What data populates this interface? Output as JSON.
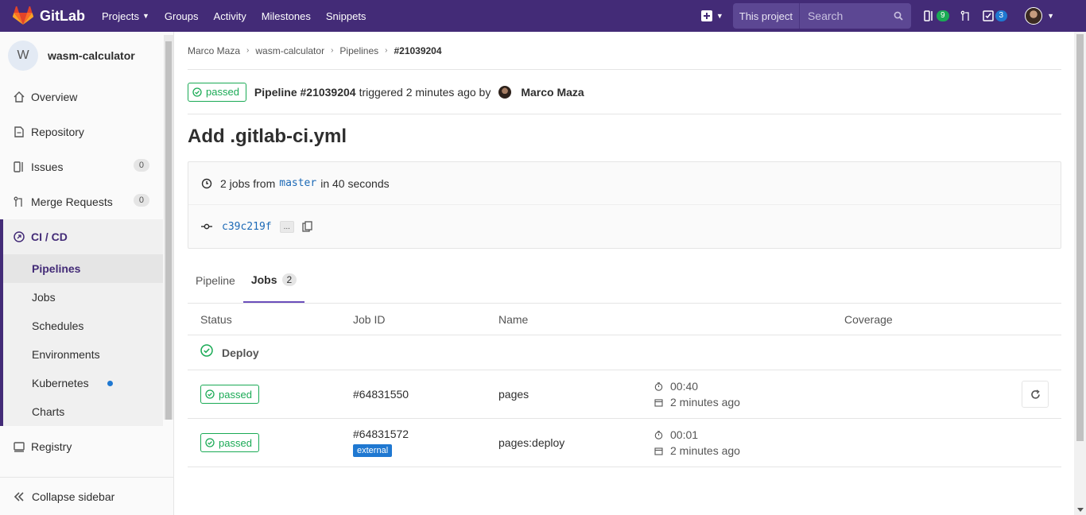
{
  "navbar": {
    "brand": "GitLab",
    "links": [
      "Projects",
      "Groups",
      "Activity",
      "Milestones",
      "Snippets"
    ],
    "search_scope": "This project",
    "search_placeholder": "Search",
    "issues_count": "9",
    "todos_count": "3",
    "colors": {
      "bg": "#432b77",
      "issues_badge": "#1aaa55",
      "todos_badge": "#1f78d1"
    }
  },
  "sidebar": {
    "project_initial": "W",
    "project_name": "wasm-calculator",
    "items": [
      {
        "label": "Overview",
        "icon": "home-icon"
      },
      {
        "label": "Repository",
        "icon": "doc-icon"
      },
      {
        "label": "Issues",
        "icon": "issues-icon",
        "count": "0"
      },
      {
        "label": "Merge Requests",
        "icon": "merge-request-icon",
        "count": "0"
      }
    ],
    "ci": {
      "label": "CI / CD",
      "sub": [
        "Pipelines",
        "Jobs",
        "Schedules",
        "Environments",
        "Kubernetes",
        "Charts"
      ]
    },
    "registry": "Registry",
    "collapse": "Collapse sidebar"
  },
  "breadcrumb": [
    "Marco Maza",
    "wasm-calculator",
    "Pipelines",
    "#21039204"
  ],
  "pipeline": {
    "status": "passed",
    "id_text": "Pipeline #21039204",
    "triggered_text": "triggered 2 minutes ago by",
    "author": "Marco Maza",
    "commit_title": "Add .gitlab-ci.yml",
    "jobs_prefix": "2 jobs from",
    "branch": "master",
    "duration_text": "in 40 seconds",
    "sha": "c39c219f",
    "ellipsis": "..."
  },
  "tabs": [
    {
      "label": "Pipeline"
    },
    {
      "label": "Jobs",
      "count": "2"
    }
  ],
  "table": {
    "headers": [
      "Status",
      "Job ID",
      "Name",
      "Coverage"
    ],
    "stage": "Deploy",
    "jobs": [
      {
        "status": "passed",
        "id": "#64831550",
        "name": "pages",
        "duration": "00:40",
        "finished": "2 minutes ago",
        "tag": ""
      },
      {
        "status": "passed",
        "id": "#64831572",
        "name": "pages:deploy",
        "duration": "00:01",
        "finished": "2 minutes ago",
        "tag": "external"
      }
    ]
  }
}
